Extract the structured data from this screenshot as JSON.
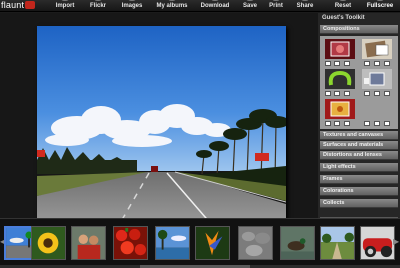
{
  "app": {
    "logo_text": "flaunt"
  },
  "toolbar": [
    {
      "name": "import",
      "label": "Import",
      "icon": "import-icon"
    },
    {
      "name": "flickr",
      "label": "Flickr",
      "icon": "flickr-icon"
    },
    {
      "name": "images",
      "label": "Images",
      "icon": "images-icon"
    },
    {
      "name": "my-albums",
      "label": "My albums",
      "icon": "albums-icon"
    },
    {
      "name": "download",
      "label": "Download",
      "icon": "download-icon"
    },
    {
      "name": "save",
      "label": "Save",
      "icon": "save-icon"
    },
    {
      "name": "print",
      "label": "Print",
      "icon": "print-icon"
    },
    {
      "name": "share",
      "label": "Share",
      "icon": "share-icon"
    },
    {
      "name": "reset",
      "label": "Reset",
      "icon": "reset-icon"
    },
    {
      "name": "fullscreen",
      "label": "Fullscree",
      "icon": "fullscreen-icon"
    }
  ],
  "panel": {
    "title": "Guest's Toolkit",
    "sections": [
      {
        "name": "compositions",
        "label": "Compositions",
        "expanded": true
      },
      {
        "name": "textures-canvases",
        "label": "Textures and canvases"
      },
      {
        "name": "surfaces-materials",
        "label": "Surfaces and materials"
      },
      {
        "name": "distortions-lenses",
        "label": "Distortions and lenses"
      },
      {
        "name": "light-effects",
        "label": "Light effects"
      },
      {
        "name": "frames",
        "label": "Frames"
      },
      {
        "name": "colorations",
        "label": "Colorations"
      },
      {
        "name": "collects",
        "label": "Collects"
      }
    ]
  },
  "filmstrip": [
    {
      "subject": "highway-palms",
      "selected": true
    },
    {
      "subject": "sunflower"
    },
    {
      "subject": "people-portrait"
    },
    {
      "subject": "red-peppers"
    },
    {
      "subject": "palm-beach"
    },
    {
      "subject": "orange-flower"
    },
    {
      "subject": "grey-stones"
    },
    {
      "subject": "ducks-water"
    },
    {
      "subject": "park-walk"
    },
    {
      "subject": "landscape-sky"
    },
    {
      "subject": "red-car"
    }
  ],
  "colors": {
    "accent": "#4a7edc",
    "logo_red": "#c2261c",
    "panel_header": "#777777"
  }
}
